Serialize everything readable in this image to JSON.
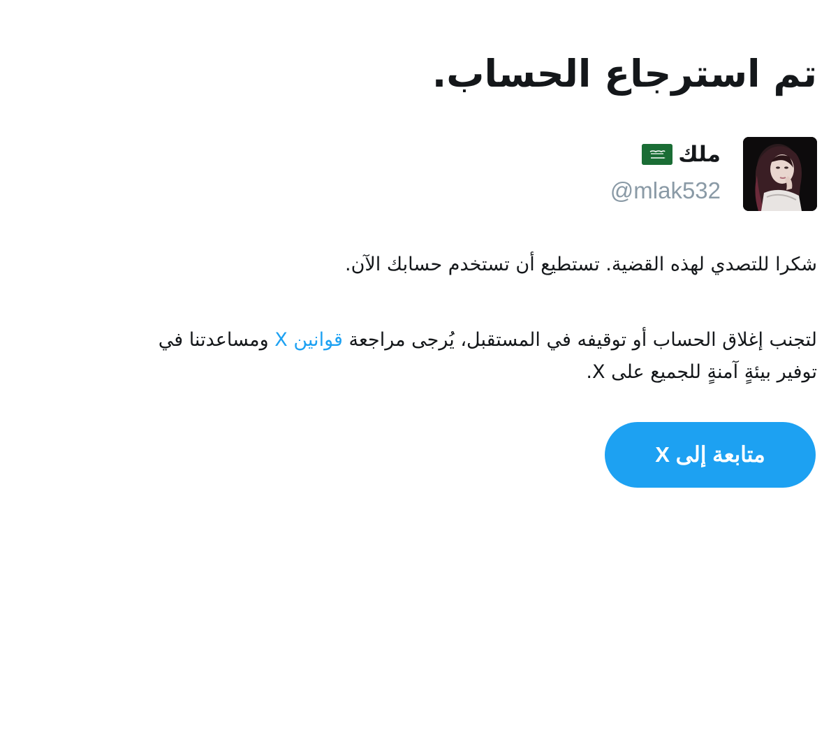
{
  "header": {
    "title": "تم استرجاع الحساب."
  },
  "account": {
    "display_name": "ملك",
    "handle": "@mlak532",
    "flag_icon": "saudi-arabia-flag-icon",
    "avatar_icon": "profile-photo"
  },
  "message": {
    "paragraph1": "شكرا للتصدي لهذه القضية. تستطيع أن تستخدم حسابك الآن.",
    "paragraph2_before_link": "لتجنب إغلاق الحساب أو توقيفه في المستقبل، يُرجى مراجعة ",
    "paragraph2_link": "قوانين X",
    "paragraph2_after_link": " ومساعدتنا في",
    "paragraph2_line2": "توفير بيئةٍ آمنةٍ للجميع على X."
  },
  "actions": {
    "continue_label": "متابعة إلى X"
  },
  "colors": {
    "accent": "#1da1f2",
    "text": "#14171a",
    "muted": "#8a9aa6",
    "flag_green": "#1a6d35"
  }
}
